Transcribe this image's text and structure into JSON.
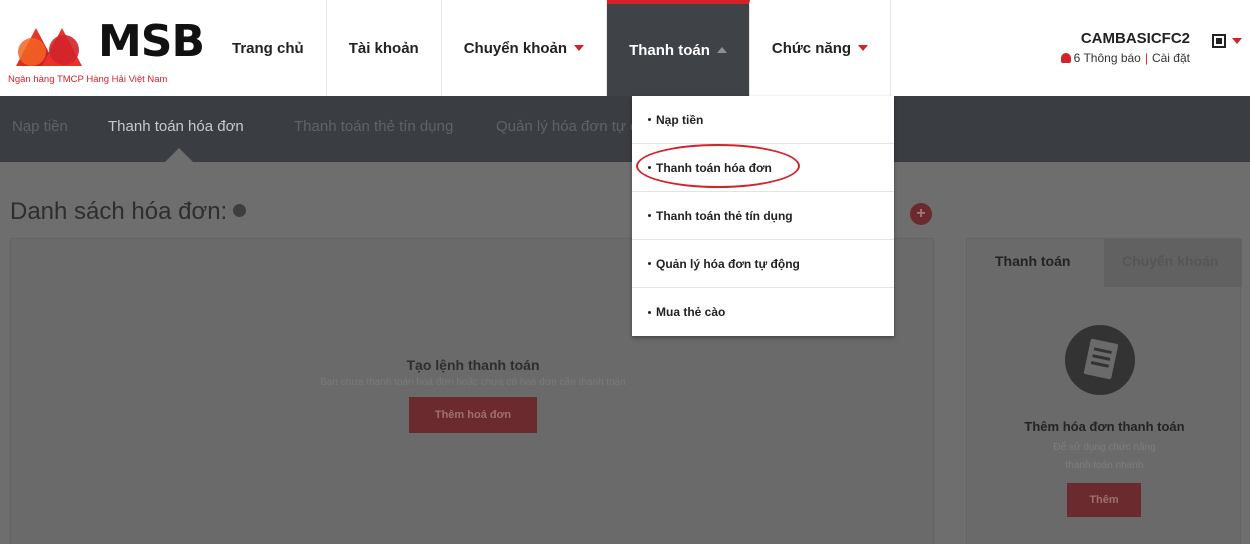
{
  "brand": {
    "name": "MSB",
    "subtitle": "Ngân hàng TMCP Hàng Hải Việt Nam",
    "accent_color": "#d2232a"
  },
  "nav": {
    "items": [
      {
        "label": "Trang chủ"
      },
      {
        "label": "Tài khoản"
      },
      {
        "label": "Chuyển khoản"
      },
      {
        "label": "Thanh toán"
      },
      {
        "label": "Chức năng"
      }
    ]
  },
  "user": {
    "name": "CAMBASICFC2",
    "notifications": "6 Thông báo",
    "settings": "Cài đặt",
    "separator": "|"
  },
  "subnav": {
    "items": [
      {
        "label": "Nạp tiền"
      },
      {
        "label": "Thanh toán hóa đơn"
      },
      {
        "label": "Thanh toán thẻ tín dụng"
      },
      {
        "label": "Quản lý hóa đơn tự động"
      }
    ]
  },
  "main": {
    "title": "Danh sách hóa đơn:",
    "add_symbol": "+",
    "empty_title": "Tạo lệnh thanh toán",
    "empty_subtitle": "Bạn chưa thanh toán hoá đơn hoặc chưa có hoá đơn cần thanh toán",
    "add_bill_label": "Thêm hoá đơn"
  },
  "side_panel": {
    "tabs": [
      {
        "label": "Thanh toán"
      },
      {
        "label": "Chuyển khoản"
      }
    ],
    "title": "Thêm hóa đơn thanh toán",
    "subtitle_line1": "Để sử dụng chức năng",
    "subtitle_line2": "thanh toán nhanh",
    "button_label": "Thêm"
  },
  "dropdown": {
    "items": [
      {
        "label": "Nạp tiền"
      },
      {
        "label": "Thanh toán hóa đơn"
      },
      {
        "label": "Thanh toán thẻ tín dụng"
      },
      {
        "label": "Quản lý hóa đơn tự động"
      },
      {
        "label": "Mua thẻ cào"
      }
    ]
  }
}
